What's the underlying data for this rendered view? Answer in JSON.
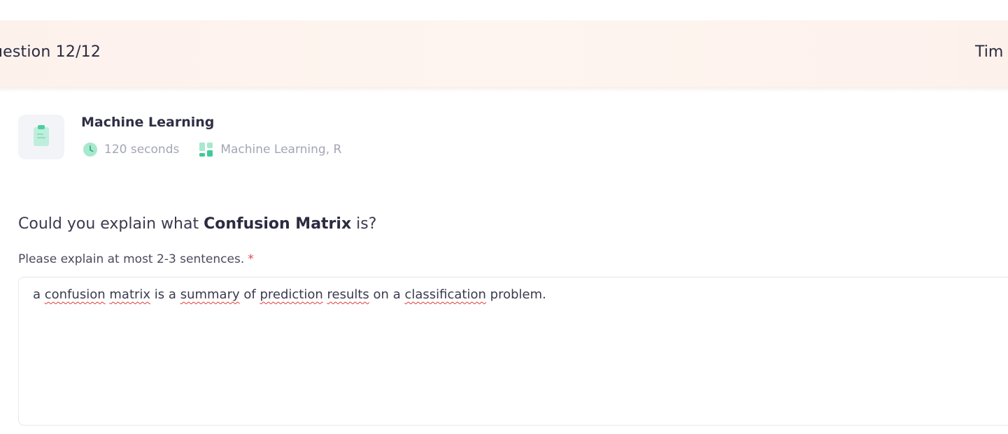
{
  "header": {
    "question_counter": "uestion 12/12",
    "timer_label": "Tim"
  },
  "question_meta": {
    "title": "Machine Learning",
    "duration": "120 seconds",
    "tags": "Machine Learning, R",
    "icons": {
      "category": "clipboard-icon",
      "duration": "clock-icon",
      "tags": "blocks-icon"
    }
  },
  "question": {
    "prefix": "Could you explain what ",
    "emphasis": "Confusion Matrix",
    "suffix": " is?"
  },
  "answer_field": {
    "label": "Please explain at most 2-3 sentences.",
    "required_marker": "*",
    "words": [
      "a",
      "confusion",
      "matrix",
      "is",
      "a",
      "summary",
      "of",
      "prediction",
      "results",
      "on",
      "a",
      "classification",
      "problem."
    ]
  },
  "colors": {
    "header_bg": "#fdf1ec",
    "accent_green": "#3ecb9a",
    "required_red": "#e24a4a",
    "spellcheck_red": "#e03c3c"
  }
}
